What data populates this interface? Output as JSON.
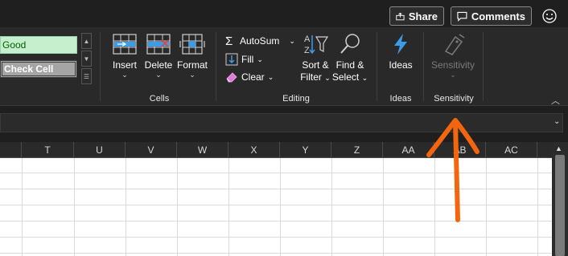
{
  "titlebar": {
    "share_label": "Share",
    "comments_label": "Comments"
  },
  "styles": {
    "good_label": "Good",
    "check_cell_label": "Check Cell"
  },
  "cells_group": {
    "label": "Cells",
    "insert_label": "Insert",
    "delete_label": "Delete",
    "format_label": "Format"
  },
  "editing_group": {
    "label": "Editing",
    "autosum_label": "AutoSum",
    "fill_label": "Fill",
    "clear_label": "Clear",
    "sort_filter_line1": "Sort &",
    "sort_filter_line2": "Filter",
    "find_select_line1": "Find &",
    "find_select_line2": "Select"
  },
  "ideas_group": {
    "label": "Ideas",
    "ideas_label": "Ideas"
  },
  "sensitivity_group": {
    "label": "Sensitivity",
    "sensitivity_label": "Sensitivity"
  },
  "columns": [
    "T",
    "U",
    "V",
    "W",
    "X",
    "Y",
    "Z",
    "AA",
    "AB",
    "AC"
  ],
  "colors": {
    "ribbon_bg": "#292929",
    "accent_blue": "#3c9ce6",
    "annotation_arrow": "#f4650f"
  }
}
